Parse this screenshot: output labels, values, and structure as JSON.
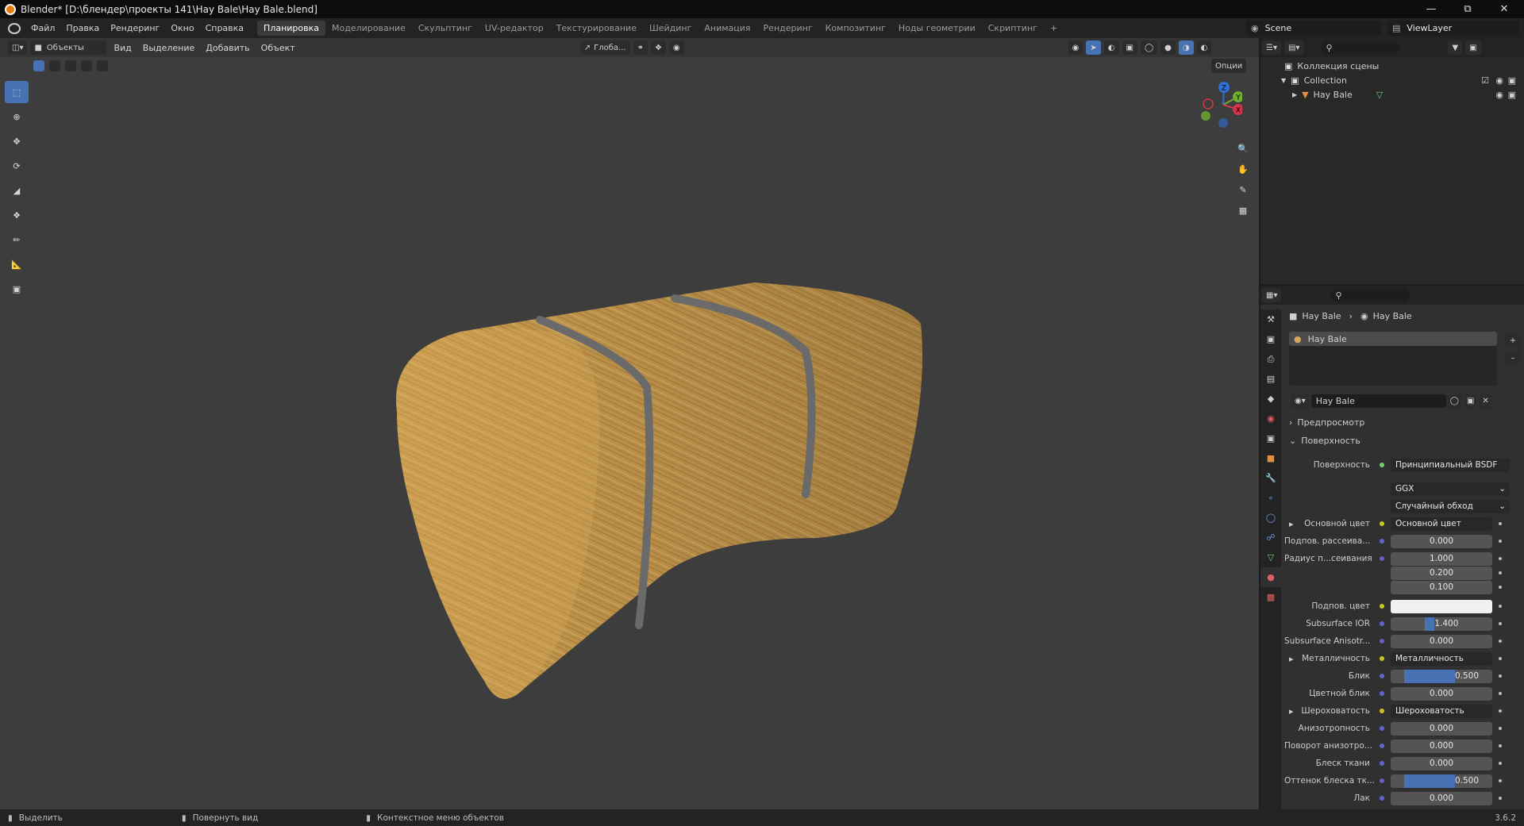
{
  "title": "Blender* [D:\\блендер\\проекты 141\\Hay Bale\\Hay Bale.blend]",
  "menu": [
    "Файл",
    "Правка",
    "Рендеринг",
    "Окно",
    "Справка"
  ],
  "workspaces": [
    {
      "label": "Планировка",
      "active": true
    },
    {
      "label": "Моделирование",
      "active": false
    },
    {
      "label": "Скульптинг",
      "active": false
    },
    {
      "label": "UV-редактор",
      "active": false
    },
    {
      "label": "Текстурирование",
      "active": false
    },
    {
      "label": "Шейдинг",
      "active": false
    },
    {
      "label": "Анимация",
      "active": false
    },
    {
      "label": "Рендеринг",
      "active": false
    },
    {
      "label": "Композитинг",
      "active": false
    },
    {
      "label": "Ноды геометрии",
      "active": false
    },
    {
      "label": "Скриптинг",
      "active": false
    }
  ],
  "add_workspace": "+",
  "scene": "Scene",
  "view_layer": "ViewLayer",
  "viewport_header": {
    "mode": "Объекты",
    "menus": [
      "Вид",
      "Выделение",
      "Добавить",
      "Объект"
    ],
    "orientation": "Глоба...",
    "options": "Опции"
  },
  "gizmo": {
    "z": "Z",
    "y": "Y",
    "x": "X"
  },
  "outliner": {
    "scene_collection": "Коллекция сцены",
    "collection": "Collection",
    "object": "Hay Bale"
  },
  "properties": {
    "breadcrumb_object": "Hay Bale",
    "breadcrumb_material": "Hay Bale",
    "slot": "Hay Bale",
    "material_name": "Hay Bale",
    "panel_preview": "Предпросмотр",
    "panel_surface": "Поверхность",
    "surface_label": "Поверхность",
    "surface_value": "Принципиальный BSDF",
    "distribution": "GGX",
    "subsurface_method": "Случайный обход",
    "rows": [
      {
        "label": "Основной цвет",
        "value": "Основной цвет",
        "type": "link",
        "expand": true
      },
      {
        "label": "Подпов. рассеива...",
        "value": "0.000",
        "type": "num",
        "fill": 0
      },
      {
        "label": "Радиус п...сеивания",
        "value": "1.000",
        "type": "num",
        "fill": 0
      },
      {
        "label": "",
        "value": "0.200",
        "type": "num",
        "fill": 0
      },
      {
        "label": "",
        "value": "0.100",
        "type": "num",
        "fill": 0
      },
      {
        "label": "Подпов. цвет",
        "value": "",
        "type": "color",
        "color": "#f0f0f0"
      },
      {
        "label": "Subsurface IOR",
        "value": "1.400",
        "type": "num",
        "fill": 0.1
      },
      {
        "label": "Subsurface Anisotr...",
        "value": "0.000",
        "type": "num",
        "fill": 0
      },
      {
        "label": "Металличность",
        "value": "Металличность",
        "type": "link",
        "expand": true
      },
      {
        "label": "Блик",
        "value": "0.500",
        "type": "num",
        "fill": 0.5
      },
      {
        "label": "Цветной блик",
        "value": "0.000",
        "type": "num",
        "fill": 0
      },
      {
        "label": "Шероховатость",
        "value": "Шероховатость",
        "type": "link",
        "expand": true
      },
      {
        "label": "Анизотропность",
        "value": "0.000",
        "type": "num",
        "fill": 0
      },
      {
        "label": "Поворот анизотро...",
        "value": "0.000",
        "type": "num",
        "fill": 0
      },
      {
        "label": "Блеск ткани",
        "value": "0.000",
        "type": "num",
        "fill": 0
      },
      {
        "label": "Оттенок блеска тк...",
        "value": "0.500",
        "type": "num",
        "fill": 0.5
      },
      {
        "label": "Лак",
        "value": "0.000",
        "type": "num",
        "fill": 0
      }
    ]
  },
  "status": {
    "select": "Выделить",
    "rotate": "Повернуть вид",
    "context": "Контекстное меню объектов",
    "version": "3.6.2"
  },
  "colors": {
    "accent": "#4772b3",
    "hay": "#c89a4e",
    "strap": "#6a6a6a"
  }
}
